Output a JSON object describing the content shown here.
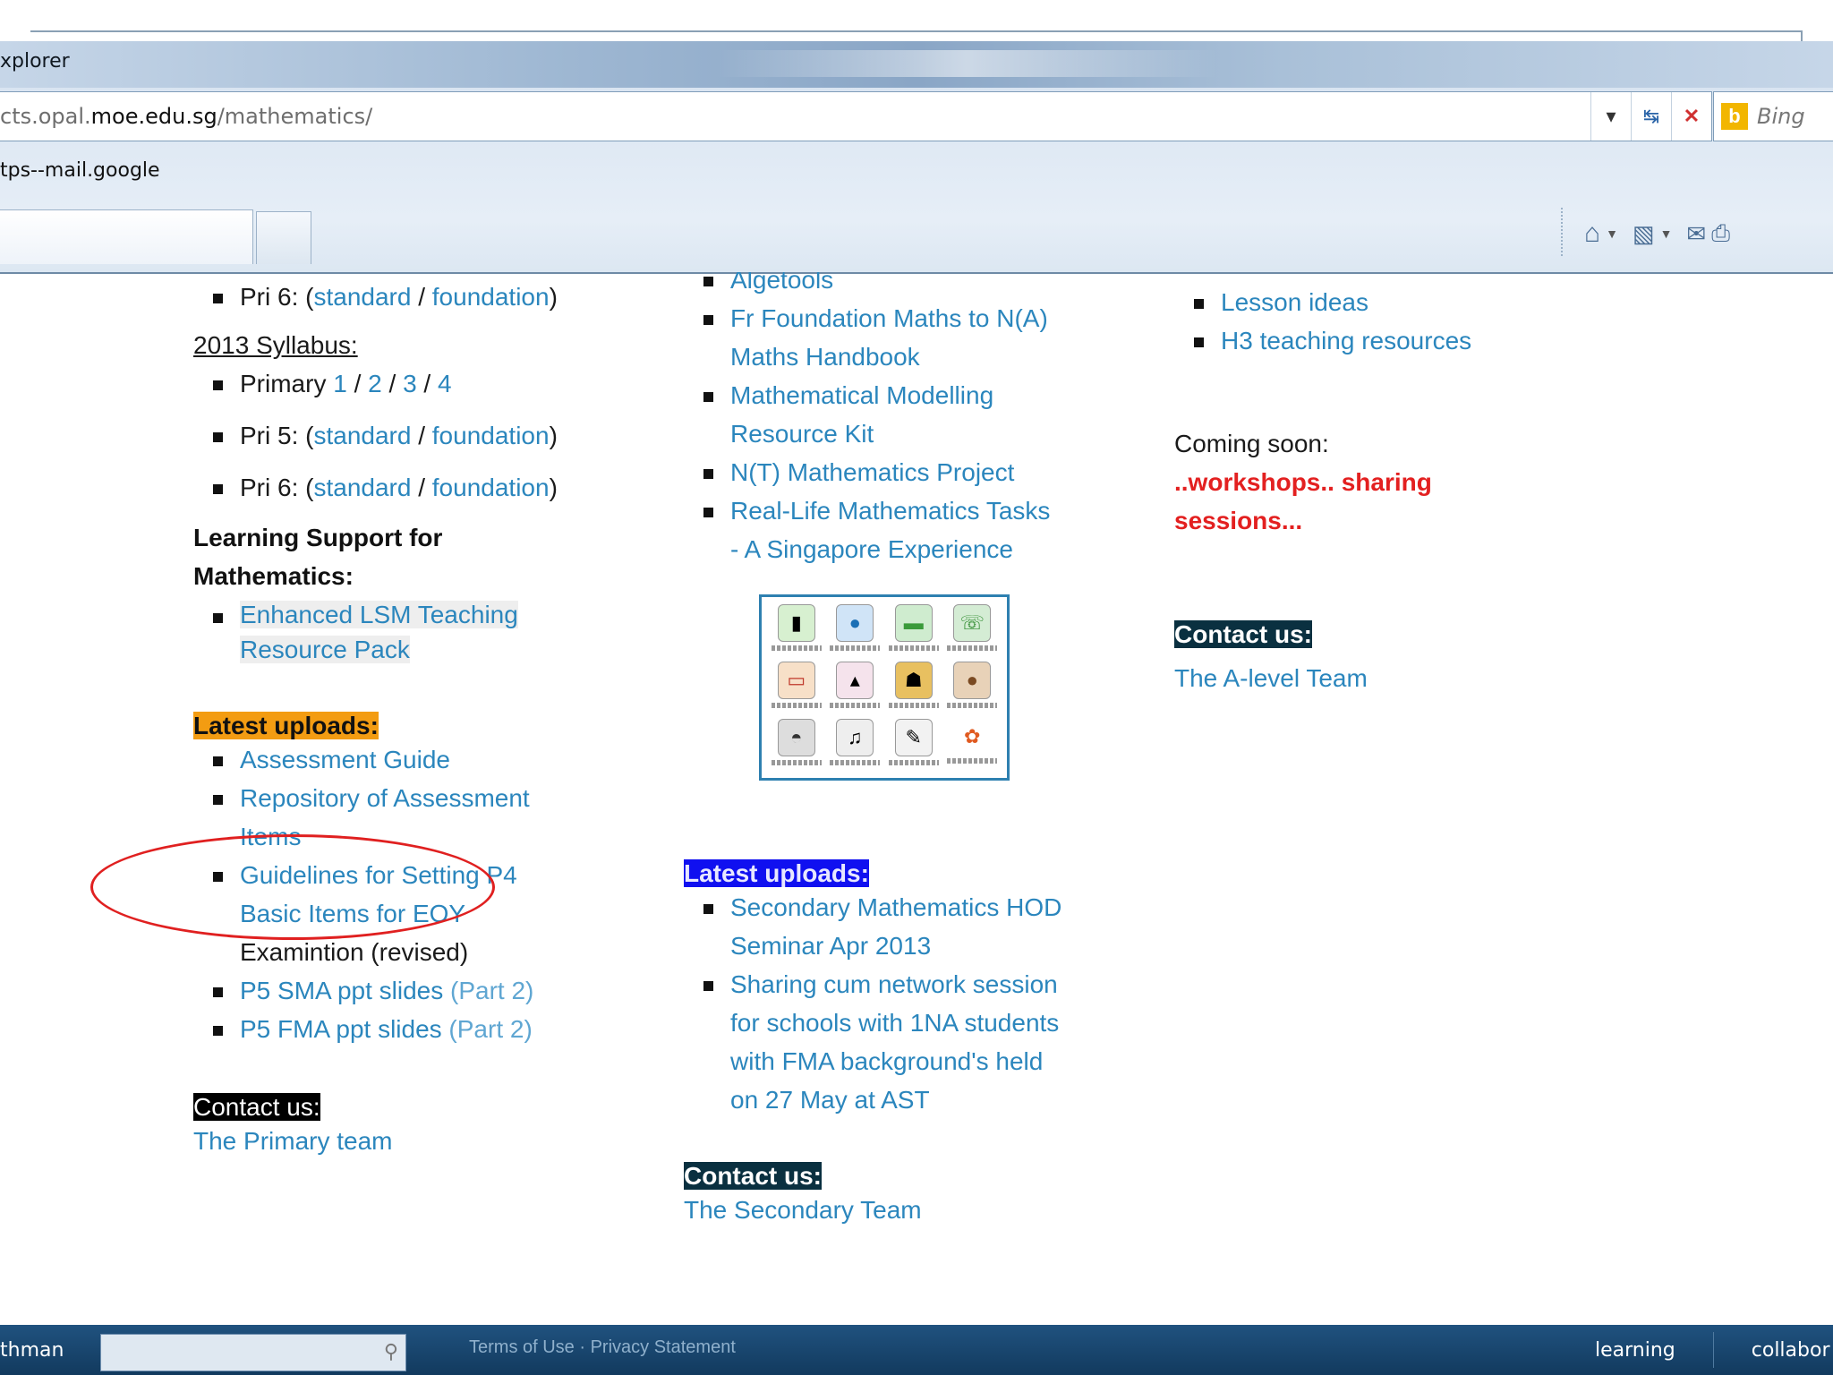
{
  "browser": {
    "window_title": "xplorer",
    "address": {
      "prefix": "cts.opal.",
      "domain": "moe.edu.sg",
      "path": "/mathematics/"
    },
    "search_provider": "Bing",
    "favorite": "tps--mail.google"
  },
  "primary": {
    "pri6_a": {
      "label": "Pri 6: (",
      "standard": "standard",
      "sep": " / ",
      "foundation": "foundation",
      "close": ")"
    },
    "syllabus_title": "2013 Syllabus:",
    "primary_row": {
      "label": "Primary ",
      "l1": "1",
      "l2": "2",
      "l3": "3",
      "l4": "4",
      "sep": " / "
    },
    "pri5": {
      "label": "Pri 5: (",
      "standard": "standard",
      "sep": " / ",
      "foundation": "foundation",
      "close": ")"
    },
    "pri6_b": {
      "label": "Pri 6: (",
      "standard": "standard",
      "sep": " / ",
      "foundation": "foundation",
      "close": ")"
    },
    "ls_heading_1": "Learning Support for",
    "ls_heading_2": "Mathematics:",
    "ls_link_1": "Enhanced LSM Teaching",
    "ls_link_2": "Resource Pack",
    "latest_label": "Latest uploads:",
    "uploads": {
      "assessment_guide": "Assessment Guide",
      "repository_1": "Repository of Assessment",
      "repository_2": "Items",
      "guidelines_1": "Guidelines for Setting P4",
      "guidelines_2": "Basic Items for EOY",
      "guidelines_3": "Examintion (revised)",
      "p5sma": "P5 SMA ppt slides",
      "p5sma_part": " (Part 2)",
      "p5fma": "P5 FMA ppt slides",
      "p5fma_part": " (Part 2)"
    },
    "contact_label": "Contact us:",
    "contact_link": "The Primary team"
  },
  "secondary": {
    "links": {
      "algetools": "Algetools",
      "fr_1": "Fr Foundation Maths to N(A)",
      "fr_2": "Maths Handbook",
      "mm_1": "Mathematical Modelling",
      "mm_2": "Resource Kit",
      "nt": "N(T) Mathematics Project",
      "rl_1": "Real-Life Mathematics Tasks",
      "rl_2": "- A Singapore Experience"
    },
    "latest_label": "Latest uploads:",
    "uploads": {
      "hod_1": "Secondary Mathematics HOD",
      "hod_2": "Seminar Apr 2013",
      "share_1": "Sharing cum network session",
      "share_2": "for schools with 1NA students",
      "share_3": "with FMA background's held",
      "share_4": "on 27 May at AST"
    },
    "contact_label": "Contact us:",
    "contact_link": "The Secondary Team"
  },
  "alevel": {
    "links": {
      "lesson": "Lesson ideas",
      "h3": "H3 teaching resources"
    },
    "coming_soon": "Coming soon:",
    "coming_1": "..workshops.. sharing",
    "coming_2": "sessions...",
    "contact_label": "Contact us:",
    "contact_link": "The A-level Team"
  },
  "footer": {
    "user": "thman",
    "terms": "Terms of Use",
    "dot": " · ",
    "privacy": "Privacy Statement",
    "nav_learning": "learning",
    "nav_collabor": "collabor"
  },
  "icons": {
    "dropdown": "chevron-down-icon",
    "compat": "compatibility-view-icon",
    "stop": "stop-icon",
    "home": "home-icon",
    "feeds": "feeds-icon",
    "mail": "mail-icon",
    "print": "print-icon",
    "search": "magnifier-icon"
  },
  "colors": {
    "link": "#2b86bd",
    "uploads_primary": "#f39c12",
    "uploads_secondary": "#1010f0",
    "contact_dark": "#0a3040",
    "coming_red": "#e32020",
    "annotation": "#e02020",
    "footer": "#1a4a74"
  }
}
